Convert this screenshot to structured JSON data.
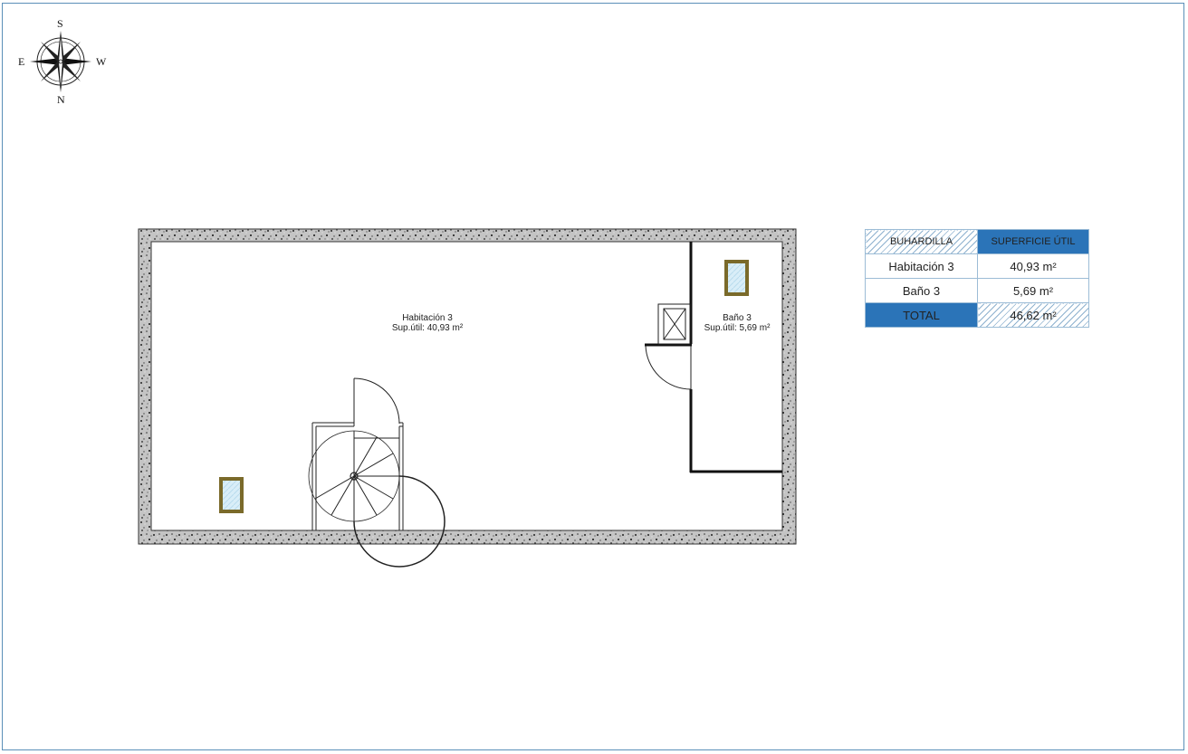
{
  "compass": {
    "top": "S",
    "bottom": "N",
    "left": "E",
    "right": "W"
  },
  "rooms": [
    {
      "name": "Habitación 3",
      "area_label": "Sup.útil: 40,93 m²"
    },
    {
      "name": "Baño 3",
      "area_label": "Sup.útil: 5,69 m²"
    }
  ],
  "table": {
    "header_floor": "BUHARDILLA",
    "header_area": "SUPERFICIE ÚTIL",
    "rows": [
      {
        "room": "Habitación 3",
        "area": "40,93 m²"
      },
      {
        "room": "Baño 3",
        "area": "5,69 m²"
      }
    ],
    "total_label": "TOTAL",
    "total_value": "46,62 m²"
  },
  "colors": {
    "frame": "#5a8fb8",
    "accent_blue": "#2b74b8",
    "wall_fill": "#c4c4c4",
    "window_frame": "#7a6a2a",
    "window_glass": "#d9eef8"
  }
}
